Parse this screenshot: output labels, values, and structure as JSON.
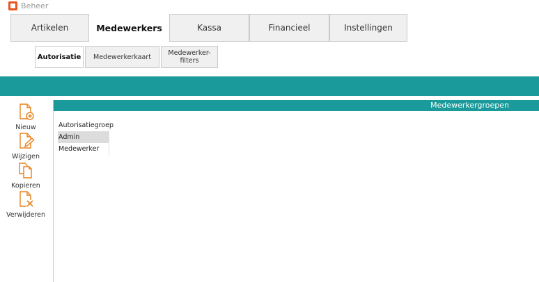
{
  "window": {
    "title": "Beheer",
    "icon": "app-icon"
  },
  "main_tabs": [
    {
      "label": "Artikelen",
      "active": false
    },
    {
      "label": "Medewerkers",
      "active": true
    },
    {
      "label": "Kassa",
      "active": false
    },
    {
      "label": "Financieel",
      "active": false
    },
    {
      "label": "Instellingen",
      "active": false
    }
  ],
  "sub_tabs": [
    {
      "label": "Autorisatie",
      "active": true
    },
    {
      "label": "Medewerkerkaart",
      "active": false
    },
    {
      "label": "Medewerker-\nfilters",
      "active": false
    }
  ],
  "colors": {
    "accent": "#1a9a9a",
    "icon_orange": "#e8821e",
    "selection": "#dcdcdc"
  },
  "toolbar": {
    "items": [
      {
        "label": "Nieuw",
        "icon": "new-document-icon"
      },
      {
        "label": "Wijzigen",
        "icon": "edit-document-icon"
      },
      {
        "label": "Kopieren",
        "icon": "copy-document-icon"
      },
      {
        "label": "Verwijderen",
        "icon": "delete-document-icon"
      }
    ]
  },
  "content": {
    "header": "Medewerkergroepen",
    "list": {
      "column_header": "Autorisatiegroep",
      "rows": [
        "Admin",
        "Medewerker"
      ],
      "selected_row": "Admin"
    }
  }
}
